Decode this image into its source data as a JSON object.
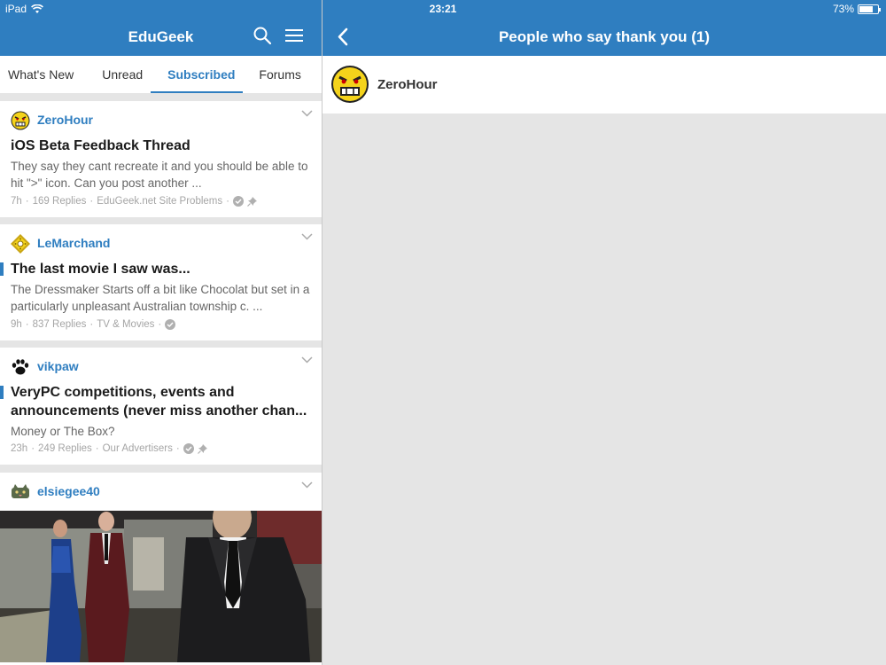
{
  "status_bar": {
    "device": "iPad",
    "time": "23:21",
    "battery": "73%",
    "battery_level": 0.73
  },
  "left_nav": {
    "title": "EduGeek"
  },
  "tabs": [
    {
      "label": "What's New",
      "active": false
    },
    {
      "label": "Unread",
      "active": false
    },
    {
      "label": "Subscribed",
      "active": true
    },
    {
      "label": "Forums",
      "active": false
    }
  ],
  "threads": [
    {
      "author": "ZeroHour",
      "avatar": "angry-face-icon",
      "title": "iOS Beta Feedback Thread",
      "snippet": "They say they cant recreate it and you should be able to hit \">\" icon. Can you post another ...",
      "age": "7h",
      "replies": "169 Replies",
      "forum": "EduGeek.net Site Problems",
      "unread": false,
      "pinned": true
    },
    {
      "author": "LeMarchand",
      "avatar": "puzzle-box-icon",
      "title": "The last movie I saw was...",
      "snippet": "The Dressmaker Starts off a bit like Chocolat but set in a particularly unpleasant Australian township c. ...",
      "age": "9h",
      "replies": "837 Replies",
      "forum": "TV & Movies",
      "unread": true,
      "pinned": false
    },
    {
      "author": "vikpaw",
      "avatar": "paw-print-icon",
      "title_line1": "VeryPC competitions, events and",
      "title_line2": "announcements (never miss another chan...",
      "snippet": "Money or The Box?",
      "age": "23h",
      "replies": "249 Replies",
      "forum": "Our Advertisers",
      "unread": true,
      "pinned": true
    },
    {
      "author": "elsiegee40",
      "avatar": "cat-avatar-icon"
    }
  ],
  "right_nav": {
    "title": "People who say thank you (1)"
  },
  "thankers": [
    {
      "name": "ZeroHour"
    }
  ],
  "colors": {
    "accent": "#2f7ec0",
    "background": "#e5e5e5"
  }
}
